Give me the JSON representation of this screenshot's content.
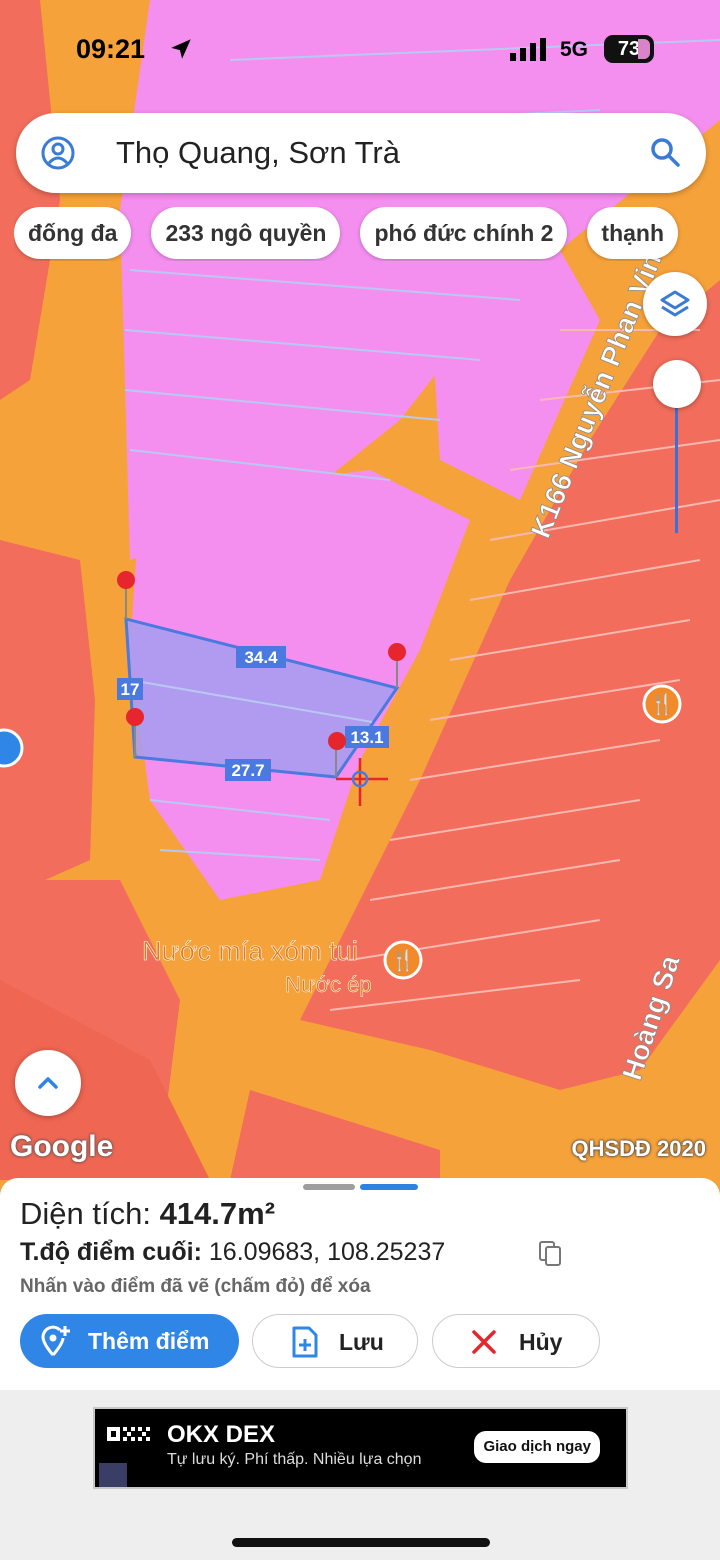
{
  "status_bar": {
    "time": "09:21",
    "network": "5G",
    "battery": "73"
  },
  "search": {
    "query": "Thọ Quang, Sơn Trà"
  },
  "chips": [
    "đống đa",
    "233 ngô quyền",
    "phó đức chính 2",
    "thạnh"
  ],
  "map": {
    "road_labels": [
      "K166 Nguyễn Phan Vinh",
      "Hoàng Sa"
    ],
    "poi": {
      "name": "Nước mía xóm tui",
      "category": "Nước ép"
    },
    "measurements": [
      "34.4",
      "17",
      "27.7",
      "13.1"
    ],
    "google_label": "Google",
    "layer_label": "QHSDĐ 2020",
    "colors": {
      "residential": "#f48ff0",
      "road": "#f6a23a",
      "commercial": "#f26d5b",
      "selection": "#a89cf0"
    }
  },
  "panel": {
    "area_label": "Diện tích:",
    "area_value": "414.7m²",
    "coord_label": "T.độ điểm cuối:",
    "coord_value": "16.09683, 108.25237",
    "hint": "Nhấn vào điểm đã vẽ (chấm đỏ) để xóa",
    "add_label": "Thêm điểm",
    "save_label": "Lưu",
    "cancel_label": "Hủy"
  },
  "ad": {
    "title": "OKX DEX",
    "subtitle": "Tự lưu ký. Phí thấp. Nhiều lựa chọn",
    "cta": "Giao dịch ngay"
  }
}
